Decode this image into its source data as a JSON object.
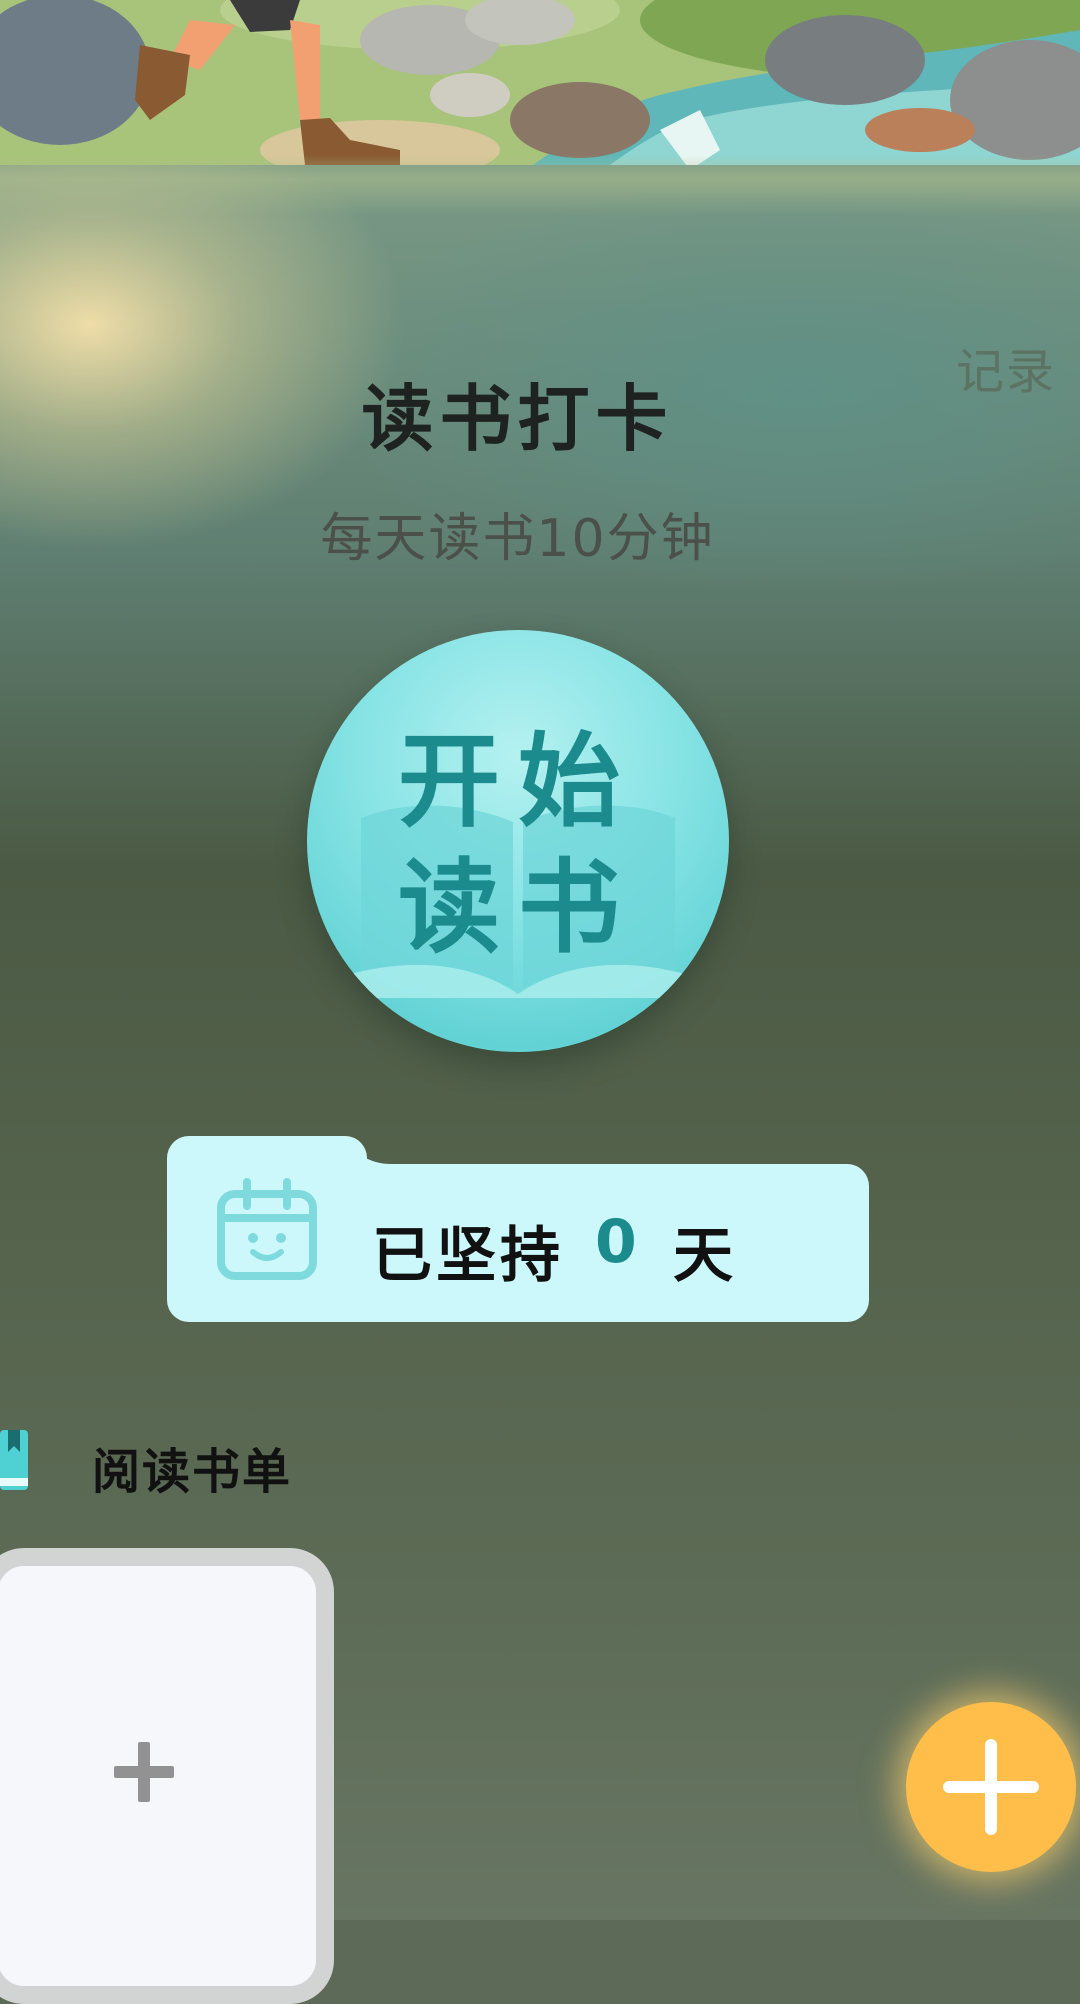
{
  "header": {
    "records_link": "记录",
    "title": "读书打卡",
    "subtitle": "每天读书10分钟"
  },
  "start_button": {
    "line1": "开始",
    "line2": "读书"
  },
  "streak": {
    "label": "已坚持",
    "count": "0",
    "unit": "天"
  },
  "reading_list": {
    "title": "阅读书单",
    "add_card_icon": "plus-icon"
  },
  "fab": {
    "icon": "plus-icon"
  },
  "colors": {
    "accent_teal": "#1b8b8d",
    "card_bg": "#cdf8fb",
    "fab_orange": "#ffbe4a"
  }
}
